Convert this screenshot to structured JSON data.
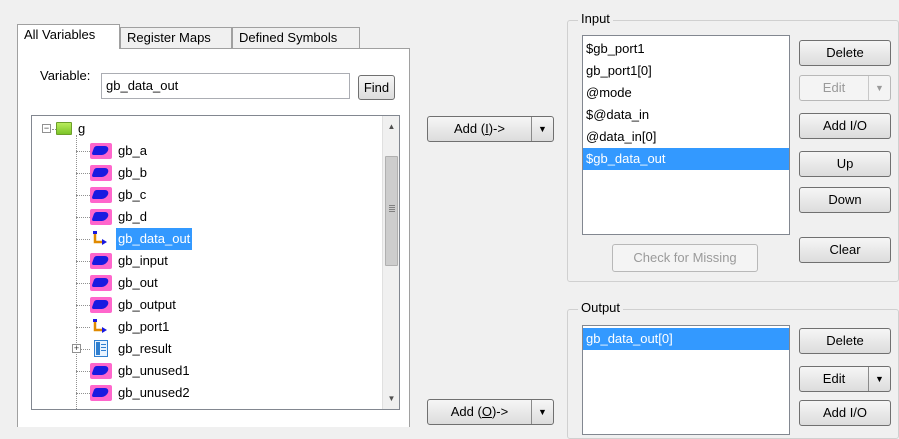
{
  "tabs": [
    "All Variables",
    "Register Maps",
    "Defined Symbols"
  ],
  "variable_label": "Variable:",
  "variable_value": "gb_data_out",
  "find_label": "Find",
  "tree": {
    "root": "g",
    "items": [
      {
        "label": "gb_a",
        "icon": "wire-icon"
      },
      {
        "label": "gb_b",
        "icon": "wire-icon"
      },
      {
        "label": "gb_c",
        "icon": "wire-icon"
      },
      {
        "label": "gb_d",
        "icon": "wire-icon"
      },
      {
        "label": "gb_data_out",
        "icon": "port-icon",
        "selected": true
      },
      {
        "label": "gb_input",
        "icon": "wire-icon"
      },
      {
        "label": "gb_out",
        "icon": "wire-icon"
      },
      {
        "label": "gb_output",
        "icon": "wire-icon"
      },
      {
        "label": "gb_port1",
        "icon": "port-icon"
      },
      {
        "label": "gb_result",
        "icon": "record-icon",
        "expandable": true
      },
      {
        "label": "gb_unused1",
        "icon": "wire-icon"
      },
      {
        "label": "gb_unused2",
        "icon": "wire-icon"
      }
    ]
  },
  "add_input": {
    "prefix": "Add (",
    "key": "I",
    "suffix": ")->"
  },
  "add_output": {
    "prefix": "Add (",
    "key": "O",
    "suffix": ")->"
  },
  "input_group": {
    "title": "Input",
    "items": [
      "$gb_port1",
      "gb_port1[0]",
      "@mode",
      "$@data_in",
      "@data_in[0]",
      "$gb_data_out"
    ],
    "selected_index": 5,
    "buttons": {
      "delete": "Delete",
      "edit": "Edit",
      "add_io": "Add I/O",
      "up": "Up",
      "down": "Down",
      "clear": "Clear"
    },
    "check_missing": "Check for Missing"
  },
  "output_group": {
    "title": "Output",
    "items": [
      "gb_data_out[0]"
    ],
    "selected_index": 0,
    "buttons": {
      "delete": "Delete",
      "edit": "Edit",
      "add_io": "Add I/O"
    }
  },
  "colors": {
    "selection": "#3399ff",
    "wire_icon_bg": "#ff66cc",
    "wire_icon_fg": "#1a1ae0"
  }
}
